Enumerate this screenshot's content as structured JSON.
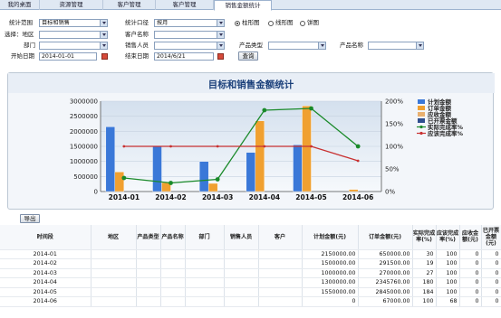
{
  "tabs": [
    "我的桌面",
    "资源管理",
    "客户管理",
    "客户管理",
    "销售金额统计"
  ],
  "filters": {
    "scope_label": "统计范围",
    "scope_value": "目标和销售",
    "period_label": "统计口径",
    "period_value": "按月",
    "chart_types": [
      "柱形图",
      "线形图",
      "饼图"
    ],
    "region_label": "选择：地区",
    "customer_label": "客户名称",
    "dept_label": "部门",
    "sales_label": "销售人员",
    "product_type_label": "产品类型",
    "product_name_label": "产品名称",
    "start_label": "开始日期",
    "start_value": "2014-01-01",
    "end_label": "结束日期",
    "end_value": "2014/6/21",
    "query_button": "查询"
  },
  "export_button": "导出",
  "chart_data": {
    "type": "bar",
    "title": "目标和销售金额统计",
    "categories": [
      "2014-01",
      "2014-02",
      "2014-03",
      "2014-04",
      "2014-05",
      "2014-06"
    ],
    "series": [
      {
        "name": "计划金额",
        "kind": "bar",
        "axis": "left",
        "color": "#3a78d8",
        "values": [
          2150000,
          1500000,
          1000000,
          1300000,
          1550000,
          0
        ]
      },
      {
        "name": "订单金额",
        "kind": "bar",
        "axis": "left",
        "color": "#f0a030",
        "values": [
          650000,
          291500,
          270000,
          2345760,
          2845000,
          67000
        ]
      },
      {
        "name": "应收金额",
        "kind": "bar",
        "axis": "left",
        "color": "#e8b070",
        "values": [
          0,
          0,
          0,
          0,
          0,
          0
        ]
      },
      {
        "name": "已开票金额",
        "kind": "bar",
        "axis": "left",
        "color": "#2f4f8f",
        "values": [
          0,
          0,
          0,
          0,
          0,
          0
        ]
      },
      {
        "name": "实际完成率%",
        "kind": "line",
        "axis": "right",
        "color": "#1a8a2a",
        "values": [
          30,
          19,
          27,
          180,
          184,
          100
        ]
      },
      {
        "name": "应该完成率%",
        "kind": "line",
        "axis": "right",
        "color": "#c83030",
        "values": [
          100,
          100,
          100,
          100,
          100,
          68
        ]
      }
    ],
    "left_ticks": [
      "0",
      "500000",
      "1000000",
      "1500000",
      "2000000",
      "2500000",
      "3000000"
    ],
    "right_ticks": [
      "0%",
      "50%",
      "100%",
      "150%",
      "200%"
    ],
    "ylim": [
      0,
      3000000
    ],
    "y2lim": [
      0,
      200
    ],
    "legend_position": "right"
  },
  "table": {
    "headers": [
      "时间段",
      "地区",
      "产品类型",
      "产品名称",
      "部门",
      "销售人员",
      "客户",
      "计划金额(元)",
      "订单金额(元)",
      "实际完成率(%)",
      "应该完成率(%)",
      "应收金额(元)",
      "已开票金额(元)"
    ],
    "rows": [
      [
        "2014-01",
        "",
        "",
        "",
        "",
        "",
        "",
        "2150000.00",
        "650000.00",
        "30",
        "100",
        "0",
        "0"
      ],
      [
        "2014-02",
        "",
        "",
        "",
        "",
        "",
        "",
        "1500000.00",
        "291500.00",
        "19",
        "100",
        "0",
        "0"
      ],
      [
        "2014-03",
        "",
        "",
        "",
        "",
        "",
        "",
        "1000000.00",
        "270000.00",
        "27",
        "100",
        "0",
        "0"
      ],
      [
        "2014-04",
        "",
        "",
        "",
        "",
        "",
        "",
        "1300000.00",
        "2345760.00",
        "180",
        "100",
        "0",
        "0"
      ],
      [
        "2014-05",
        "",
        "",
        "",
        "",
        "",
        "",
        "1550000.00",
        "2845000.00",
        "184",
        "100",
        "0",
        "0"
      ],
      [
        "2014-06",
        "",
        "",
        "",
        "",
        "",
        "",
        "0",
        "67000.00",
        "100",
        "68",
        "0",
        "0"
      ]
    ]
  }
}
